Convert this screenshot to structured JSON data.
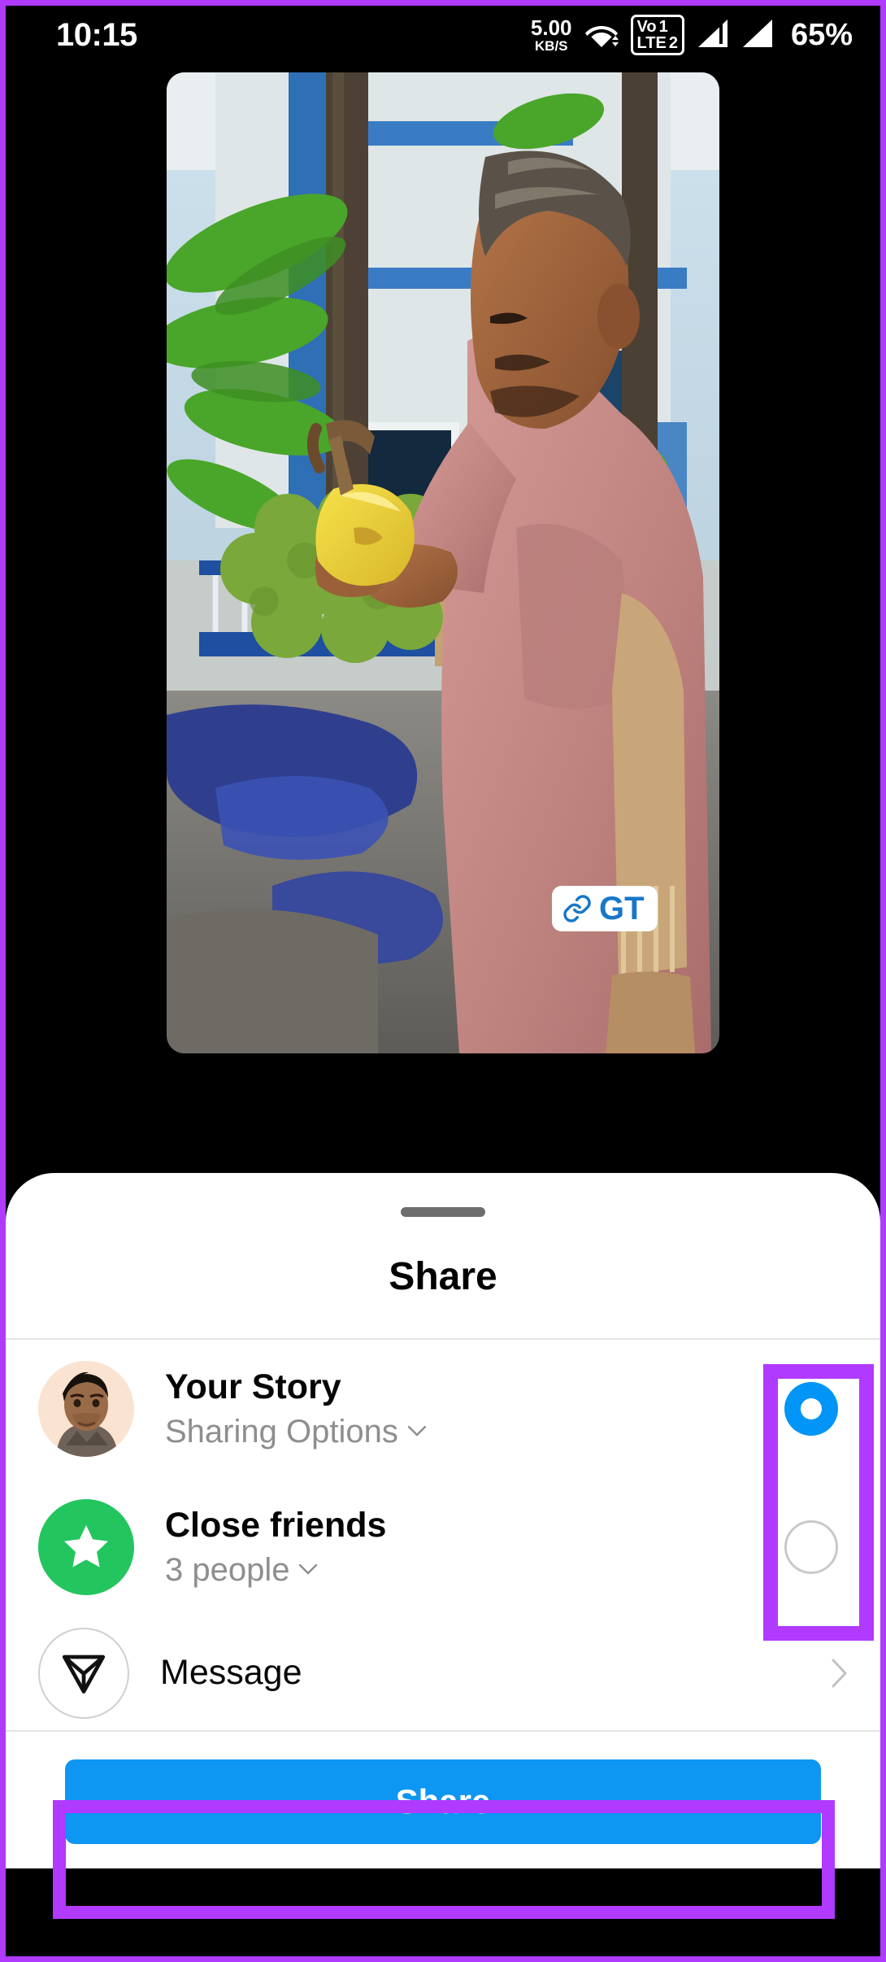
{
  "status_bar": {
    "clock": "10:15",
    "net_speed_value": "5.00",
    "net_speed_unit": "KB/S",
    "wifi_icon": "wifi-icon",
    "volte_line1_label": "Vo",
    "volte_sim1": "1",
    "volte_line2_label": "LTE",
    "volte_sim2": "2",
    "signal_sim1_icon": "signal-bars-icon",
    "signal_sim2_icon": "signal-bars-icon",
    "battery_percent": "65%"
  },
  "media": {
    "alt": "Man holding a freshly cut yellow coconut at a street stall",
    "watermark": {
      "icon": "link-icon",
      "text": "GT"
    }
  },
  "sheet": {
    "grabber": "drag-handle",
    "title": "Share",
    "rows": [
      {
        "id": "your-story",
        "avatar_icon": "user-avatar",
        "title": "Your Story",
        "subtitle": "Sharing Options",
        "subtitle_icon": "chevron-down-icon",
        "control": "radio",
        "selected": true
      },
      {
        "id": "close-friends",
        "avatar_icon": "star-icon",
        "title": "Close friends",
        "subtitle": "3 people",
        "subtitle_icon": "chevron-down-icon",
        "control": "radio",
        "selected": false
      },
      {
        "id": "message",
        "avatar_icon": "send-icon",
        "title": "Message",
        "subtitle": "",
        "control": "chevron",
        "control_icon": "chevron-right-icon"
      }
    ],
    "share_button_label": "Share"
  },
  "nav_bar": {
    "gesture_pill": "home-gesture-pill"
  },
  "colors": {
    "accent_blue": "#0095f6",
    "share_button_blue": "#0d96f2",
    "annotation_purple": "#b03aff",
    "close_friends_green": "#23c55e",
    "watermark_blue": "#1877c9",
    "subtitle_gray": "#8e8e8e"
  }
}
